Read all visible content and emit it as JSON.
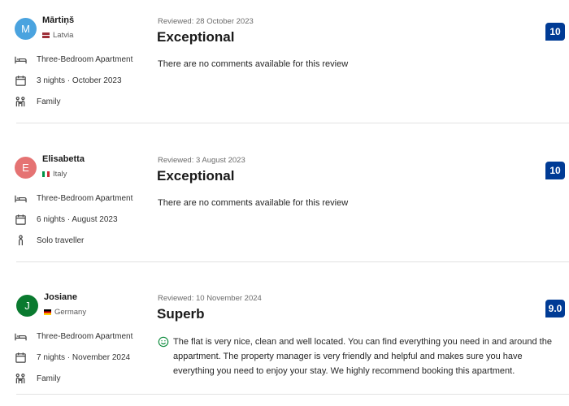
{
  "reviews": [
    {
      "initial": "M",
      "name": "Mārtiņš",
      "country": "Latvia",
      "room": "Three-Bedroom Apartment",
      "stay": "3 nights · October 2023",
      "traveller": "Family",
      "reviewed": "Reviewed: 28 October 2023",
      "headline": "Exceptional",
      "comment": "There are no comments available for this review",
      "score": "10",
      "avatar_color": "#4aa3df"
    },
    {
      "initial": "E",
      "name": "Elisabetta",
      "country": "Italy",
      "room": "Three-Bedroom Apartment",
      "stay": "6 nights · August 2023",
      "traveller": "Solo traveller",
      "reviewed": "Reviewed: 3 August 2023",
      "headline": "Exceptional",
      "comment": "There are no comments available for this review",
      "score": "10",
      "avatar_color": "#e57373"
    },
    {
      "initial": "J",
      "name": "Josiane",
      "country": "Germany",
      "room": "Three-Bedroom Apartment",
      "stay": "7 nights · November 2024",
      "traveller": "Family",
      "reviewed": "Reviewed: 10 November 2024",
      "headline": "Superb",
      "comment": "The flat is very nice, clean and well located. You can find everything you need in and around the appartment. The property manager is very friendly and helpful and makes sure you have everything you need to enjoy your stay. We highly recommend booking this apartment.",
      "score": "9.0",
      "avatar_color": "#0a7a2f"
    }
  ],
  "colors": {
    "score_badge": "#003b95",
    "divider": "#e2e2e2",
    "positive_icon": "#0a8a3a"
  }
}
